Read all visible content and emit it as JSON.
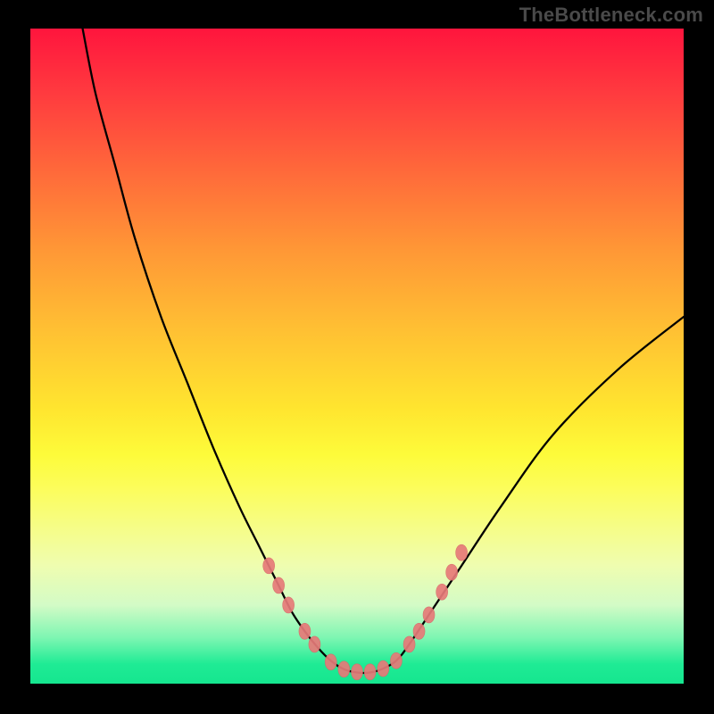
{
  "watermark": "TheBottleneck.com",
  "colors": {
    "frame": "#000000",
    "curve": "#000000",
    "marker_fill": "#e77a79",
    "marker_stroke": "#d86a69"
  },
  "chart_data": {
    "type": "line",
    "title": "",
    "xlabel": "",
    "ylabel": "",
    "xlim": [
      0,
      100
    ],
    "ylim": [
      0,
      100
    ],
    "grid": false,
    "legend": false,
    "series": [
      {
        "name": "curve",
        "x": [
          8,
          10,
          13,
          16,
          20,
          24,
          28,
          32,
          35,
          38,
          40,
          42,
          44,
          46,
          48,
          50,
          52,
          54,
          56,
          58,
          62,
          66,
          72,
          80,
          90,
          100
        ],
        "y": [
          100,
          90,
          79,
          68,
          56,
          46,
          36,
          27,
          21,
          15,
          11,
          8,
          5.5,
          3.5,
          2.2,
          1.7,
          1.7,
          2.3,
          3.5,
          6,
          12,
          18,
          27,
          38,
          48,
          56
        ]
      }
    ],
    "markers": {
      "x": [
        36.5,
        38,
        39.5,
        42,
        43.5,
        46,
        48,
        50,
        52,
        54,
        56,
        58,
        59.5,
        61,
        63,
        64.5,
        66
      ],
      "y": [
        18,
        15,
        12,
        8,
        6,
        3.3,
        2.2,
        1.8,
        1.8,
        2.3,
        3.5,
        6,
        8,
        10.5,
        14,
        17,
        20
      ],
      "rx": 6.5,
      "ry": 9
    }
  }
}
